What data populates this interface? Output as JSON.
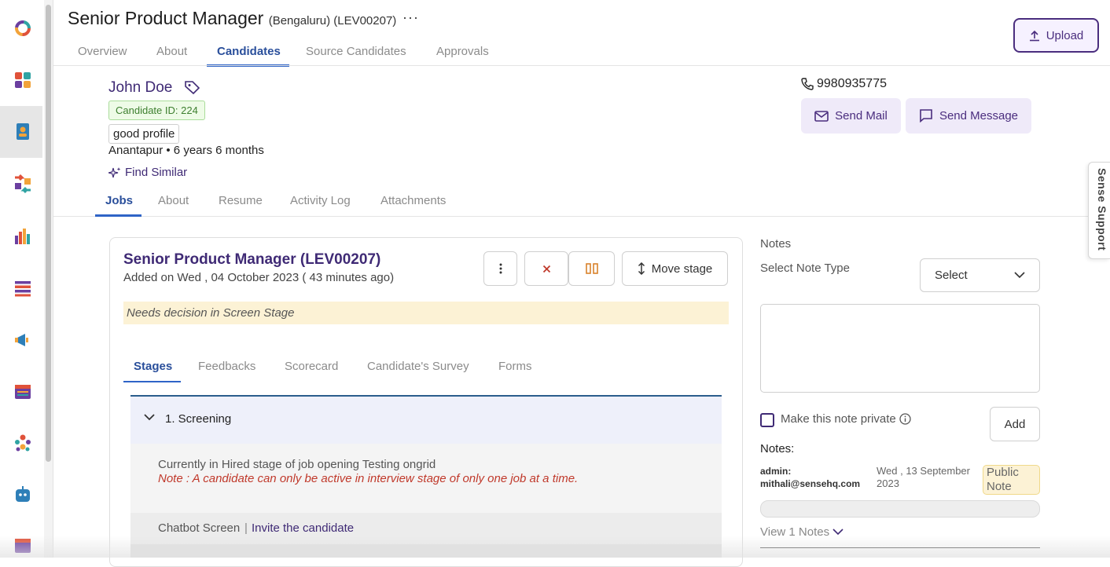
{
  "colors": {
    "brand": "#3f2a75",
    "accent": "#2f64c7",
    "note_text": "#c0392b",
    "warning_bg": "#fcf2d5"
  },
  "sidebar": {
    "items": [
      {
        "icon": "logo-ring-icon"
      },
      {
        "icon": "dashboard-grid-icon"
      },
      {
        "icon": "candidate-profile-icon",
        "active": true
      },
      {
        "icon": "arrows-exchange-icon"
      },
      {
        "icon": "bar-chart-icon"
      },
      {
        "icon": "list-icon"
      },
      {
        "icon": "megaphone-icon"
      },
      {
        "icon": "calendar-icon"
      },
      {
        "icon": "people-icon"
      },
      {
        "icon": "bot-icon"
      },
      {
        "icon": "window-icon"
      }
    ]
  },
  "header": {
    "title": "Senior Product Manager",
    "subtitle": "(Bengaluru) (LEV00207)",
    "more": "···",
    "upload_label": "Upload",
    "tabs": [
      "Overview",
      "About",
      "Candidates",
      "Source Candidates",
      "Approvals"
    ],
    "active_tab": "Candidates"
  },
  "candidate": {
    "name": "John Doe",
    "id_label": "Candidate ID: 224",
    "tag": "good profile",
    "location_experience": "Anantapur • 6 years 6 months",
    "find_similar": "Find Similar",
    "phone": "9980935775",
    "send_mail": "Send Mail",
    "send_message": "Send Message",
    "tabs": [
      "Jobs",
      "About",
      "Resume",
      "Activity Log",
      "Attachments"
    ],
    "active_tab": "Jobs"
  },
  "job_card": {
    "title": "Senior Product Manager (LEV00207)",
    "added": "Added on Wed , 04 October 2023 ( 43 minutes ago)",
    "move_stage": "Move stage",
    "decision": "Needs decision in Screen Stage",
    "tabs": [
      "Stages",
      "Feedbacks",
      "Scorecard",
      "Candidate's Survey",
      "Forms"
    ],
    "active_tab": "Stages",
    "stage_title": "1. Screening",
    "status": "Currently in Hired stage of job opening Testing ongrid",
    "note": "Note : A candidate can only be active in interview stage of only one job at a time.",
    "chatbot_label": "Chatbot Screen",
    "chatbot_sep": "|",
    "invite_link": "Invite the candidate"
  },
  "notes": {
    "title": "Notes",
    "type_label": "Select Note Type",
    "select_value": "Select",
    "textarea_value": "",
    "private_label": "Make this note private",
    "add_label": "Add",
    "list_label": "Notes:",
    "entry": {
      "author": "admin: mithali@sensehq.com",
      "date": "Wed , 13 September 2023",
      "visibility": "Public Note"
    },
    "view_more": "View 1 Notes"
  },
  "support": {
    "label": "Sense Support"
  }
}
